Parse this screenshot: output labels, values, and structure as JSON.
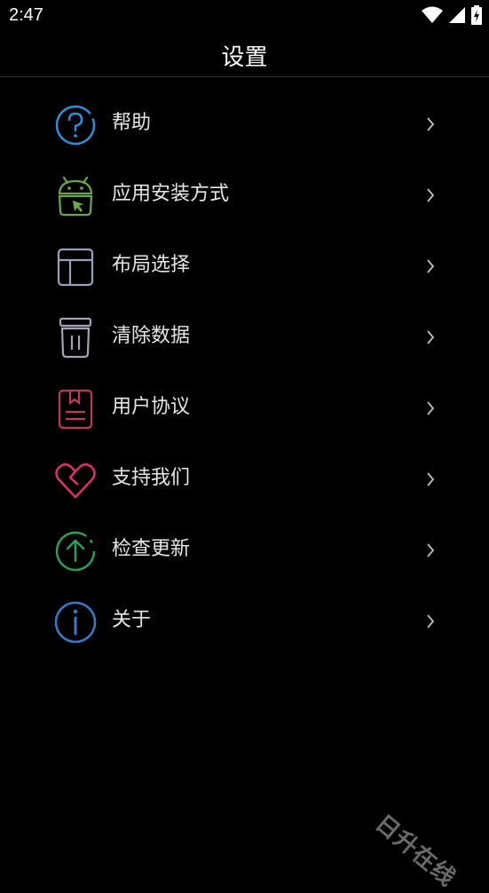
{
  "status_bar": {
    "time": "2:47"
  },
  "header": {
    "title": "设置"
  },
  "menu": [
    {
      "label": "帮助",
      "icon": "help-icon",
      "color": "#2f8fd8"
    },
    {
      "label": "应用安装方式",
      "icon": "android-install-icon",
      "color": "#6aa84f"
    },
    {
      "label": "布局选择",
      "icon": "layout-icon",
      "color": "#9aa0b8"
    },
    {
      "label": "清除数据",
      "icon": "trash-icon",
      "color": "#a0a4b4"
    },
    {
      "label": "用户协议",
      "icon": "agreement-icon",
      "color": "#c0395a"
    },
    {
      "label": "支持我们",
      "icon": "heart-icon",
      "color": "#e0326a"
    },
    {
      "label": "检查更新",
      "icon": "update-icon",
      "color": "#2e9e5a"
    },
    {
      "label": "关于",
      "icon": "info-icon",
      "color": "#3a78c8"
    }
  ],
  "watermark": "日升在线"
}
